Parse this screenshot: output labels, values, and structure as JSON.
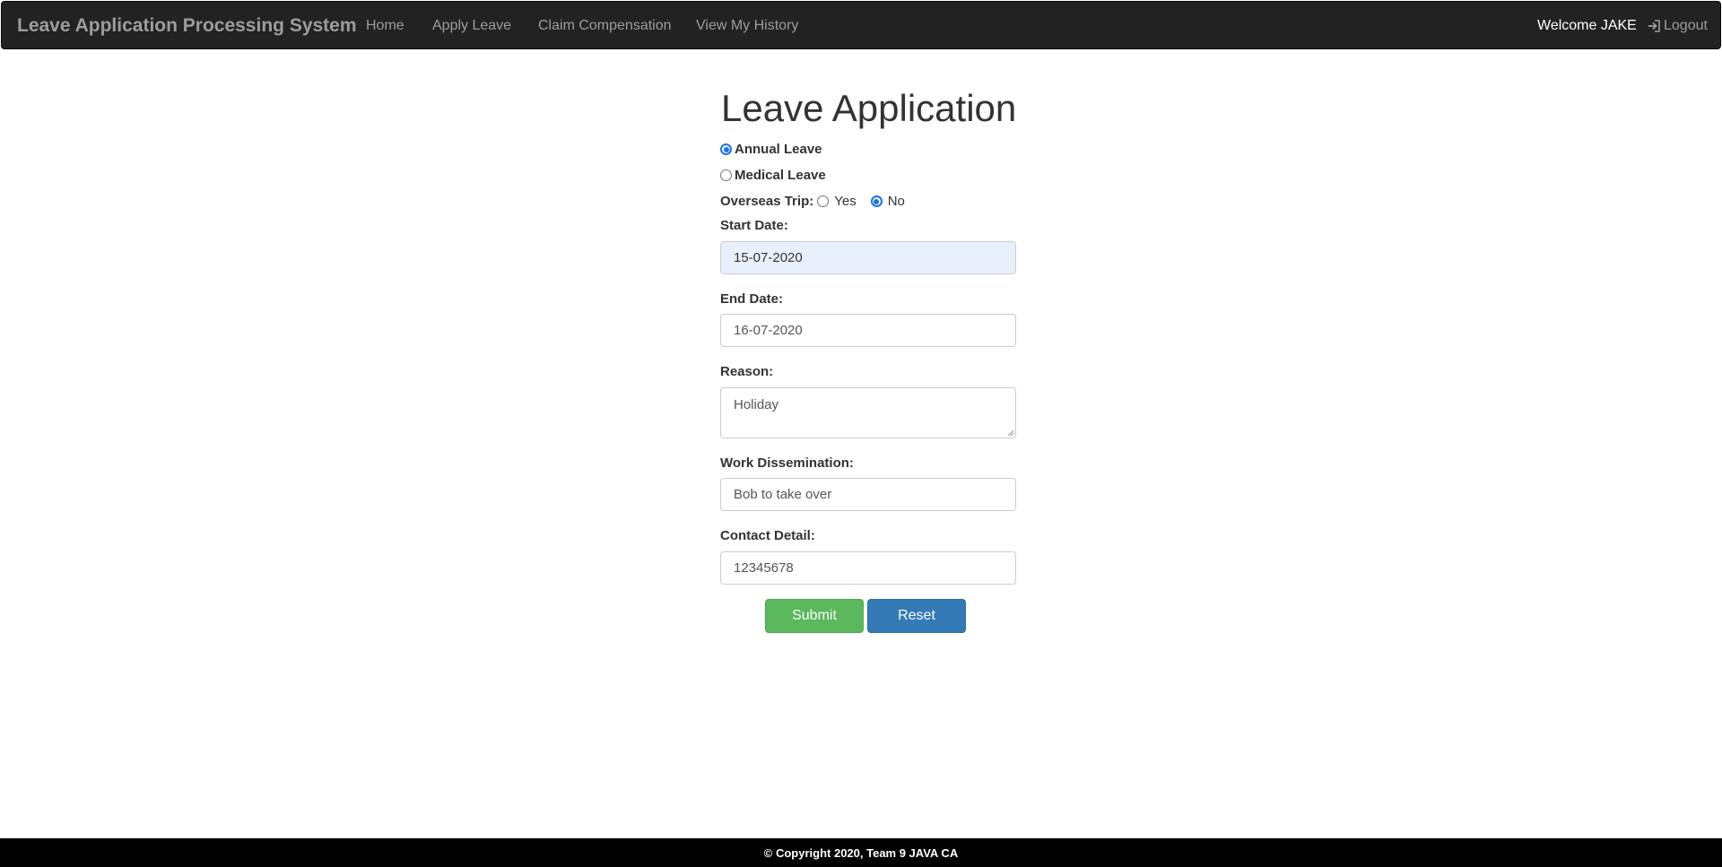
{
  "nav": {
    "brand": "Leave Application Processing System",
    "items": [
      {
        "label": "Home"
      },
      {
        "label": "Apply Leave"
      },
      {
        "label": "Claim Compensation"
      },
      {
        "label": "View My History"
      }
    ],
    "welcome": "Welcome JAKE",
    "logout_label": "Logout",
    "logout_icon": "log-in-icon"
  },
  "form": {
    "title": "Leave Application",
    "leave_types": [
      {
        "label": "Annual Leave",
        "checked": true
      },
      {
        "label": "Medical Leave",
        "checked": false
      }
    ],
    "overseas": {
      "label": "Overseas Trip:",
      "options": [
        {
          "label": "Yes",
          "checked": false
        },
        {
          "label": "No",
          "checked": true
        }
      ]
    },
    "start_date": {
      "label": "Start Date:",
      "value": "15-07-2020"
    },
    "end_date": {
      "label": "End Date:",
      "value": "16-07-2020"
    },
    "reason": {
      "label": "Reason:",
      "value": "Holiday"
    },
    "work_dissemination": {
      "label": "Work Dissemination:",
      "value": "Bob to take over"
    },
    "contact_detail": {
      "label": "Contact Detail:",
      "value": "12345678"
    },
    "submit_label": "Submit",
    "reset_label": "Reset"
  },
  "footer": {
    "text": "© Copyright 2020, Team 9 JAVA CA"
  },
  "colors": {
    "navbar": "#222222",
    "submit": "#5cb85c",
    "reset": "#337ab7",
    "radio_accent": "#1a73e8",
    "autofill": "#e8f0fe"
  }
}
